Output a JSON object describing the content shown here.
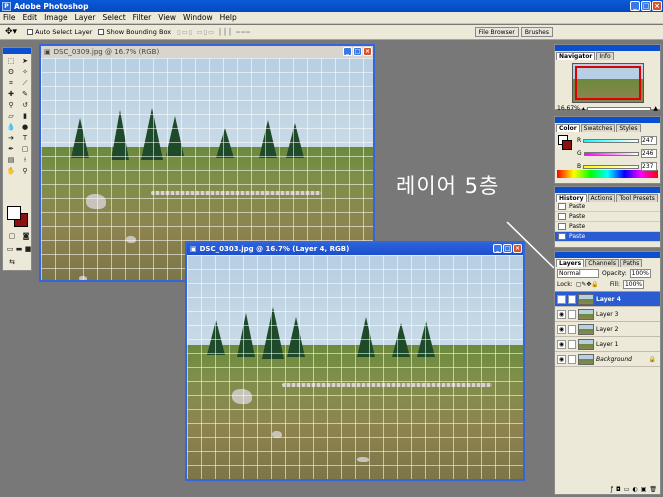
{
  "window": {
    "title": "Adobe Photoshop",
    "app_icon": "ps-icon"
  },
  "menu": [
    "File",
    "Edit",
    "Image",
    "Layer",
    "Select",
    "Filter",
    "View",
    "Window",
    "Help"
  ],
  "options_bar": {
    "auto_select_layer": "Auto Select Layer",
    "show_bounding_box": "Show Bounding Box",
    "tabs": [
      "File Browser",
      "Brushes"
    ]
  },
  "doc1": {
    "title": "DSC_0309.jpg @ 16.7% (RGB)"
  },
  "doc2": {
    "title": "DSC_0303.jpg @ 16.7% (Layer 4, RGB)"
  },
  "navigator": {
    "tabs": [
      "Navigator",
      "Info"
    ],
    "zoom": "16.67%"
  },
  "color": {
    "tabs": [
      "Color",
      "Swatches",
      "Styles"
    ],
    "channels": [
      {
        "label": "R",
        "value": "247"
      },
      {
        "label": "G",
        "value": "246"
      },
      {
        "label": "B",
        "value": "237"
      }
    ]
  },
  "history": {
    "tabs": [
      "History",
      "Actions",
      "Tool Presets"
    ],
    "items": [
      "Paste",
      "Paste",
      "Paste",
      "Paste"
    ]
  },
  "layers": {
    "tabs": [
      "Layers",
      "Channels",
      "Paths"
    ],
    "blend_mode": "Normal",
    "opacity_label": "Opacity:",
    "opacity": "100%",
    "lock_label": "Lock:",
    "fill_label": "Fill:",
    "fill": "100%",
    "items": [
      "Layer 4",
      "Layer 3",
      "Layer 2",
      "Layer 1",
      "Background"
    ]
  },
  "annotation": "레이어 5층",
  "colors": {
    "accent": "#0a4fd0",
    "selection": "#2a5bd0",
    "bg_swatch": "#8b1010"
  }
}
